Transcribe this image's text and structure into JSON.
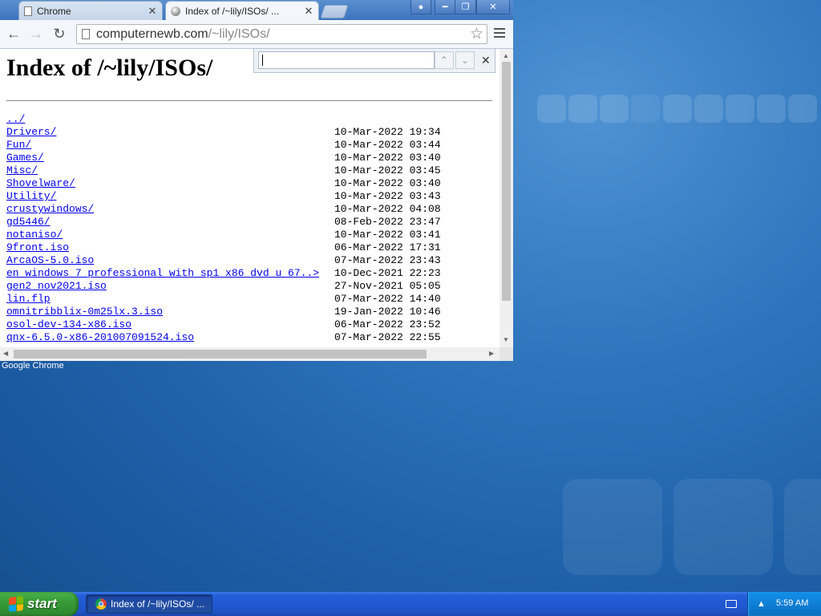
{
  "browser": {
    "tabs": [
      {
        "title": "Chrome"
      },
      {
        "title": "Index of /~lily/ISOs/ ..."
      }
    ],
    "url_host": "computernewb.com",
    "url_path": "/~lily/ISOs/",
    "window_label": "Google Chrome"
  },
  "page": {
    "heading": "Index of /~lily/ISOs/",
    "entries": [
      {
        "name": "../",
        "date": ""
      },
      {
        "name": "Drivers/",
        "date": "10-Mar-2022 19:34"
      },
      {
        "name": "Fun/",
        "date": "10-Mar-2022 03:44"
      },
      {
        "name": "Games/",
        "date": "10-Mar-2022 03:40"
      },
      {
        "name": "Misc/",
        "date": "10-Mar-2022 03:45"
      },
      {
        "name": "Shovelware/",
        "date": "10-Mar-2022 03:40"
      },
      {
        "name": "Utility/",
        "date": "10-Mar-2022 03:43"
      },
      {
        "name": "crustywindows/",
        "date": "10-Mar-2022 04:08"
      },
      {
        "name": "gd5446/",
        "date": "08-Feb-2022 23:47"
      },
      {
        "name": "notaniso/",
        "date": "10-Mar-2022 03:41"
      },
      {
        "name": "9front.iso",
        "date": "06-Mar-2022 17:31"
      },
      {
        "name": "ArcaOS-5.0.iso",
        "date": "07-Mar-2022 23:43"
      },
      {
        "name": "en_windows_7_professional_with_sp1_x86_dvd_u_67..>",
        "date": "10-Dec-2021 22:23"
      },
      {
        "name": "gen2_nov2021.iso",
        "date": "27-Nov-2021 05:05"
      },
      {
        "name": "lin.flp",
        "date": "07-Mar-2022 14:40"
      },
      {
        "name": "omnitribblix-0m25lx.3.iso",
        "date": "19-Jan-2022 10:46"
      },
      {
        "name": "osol-dev-134-x86.iso",
        "date": "06-Mar-2022 23:52"
      },
      {
        "name": "qnx-6.5.0-x86-201007091524.iso",
        "date": "07-Mar-2022 22:55"
      }
    ]
  },
  "findbar": {
    "value": ""
  },
  "taskbar": {
    "start_label": "start",
    "task_label": "Index of /~lily/ISOs/ ...",
    "clock": "5:59 AM"
  },
  "icons": {
    "reload": "reload-icon",
    "back": "back-icon",
    "forward": "forward-icon",
    "star": "star-icon",
    "menu": "menu-icon"
  }
}
